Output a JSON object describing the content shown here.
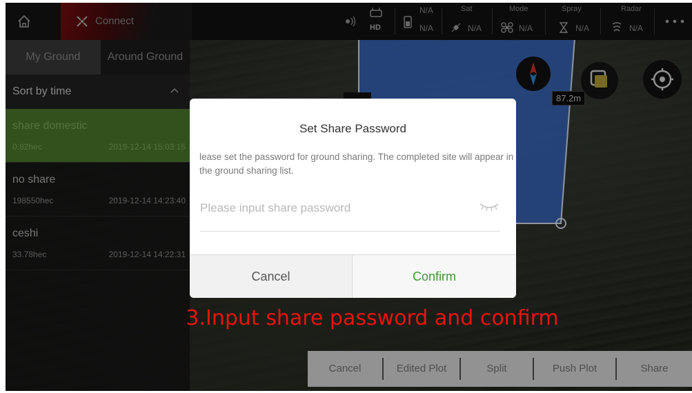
{
  "topbar": {
    "connect_label": "Connect",
    "hd_label": "HD",
    "battery_na": "N/A",
    "status_na_top": "N/A",
    "sat_title": "Sat",
    "sat_value": "N/A",
    "mode_title": "Mode",
    "mode_value": "N/A",
    "spray_title": "Spray",
    "spray_value": "N/A",
    "radar_title": "Radar",
    "radar_value": "N/A"
  },
  "left_panel": {
    "tabs": [
      {
        "label": "My Ground"
      },
      {
        "label": "Around Ground"
      }
    ],
    "sort_label": "Sort by time",
    "items": [
      {
        "name": "share domestic",
        "area": "0.82hec",
        "date": "2019-12-14 15:03:15",
        "selected": true
      },
      {
        "name": "no share",
        "area": "198550hec",
        "date": "2019-12-14 14:23:40",
        "selected": false
      },
      {
        "name": "ceshi",
        "area": "33.78hec",
        "date": "2019-12-14 14:22:31",
        "selected": false
      }
    ]
  },
  "map": {
    "distance_label": "87.2m"
  },
  "dialog": {
    "title": "Set Share Password",
    "description": "lease set the password for ground sharing. The completed site will appear in the ground sharing list.",
    "input_placeholder": "Please input share password",
    "input_value": "",
    "cancel_label": "Cancel",
    "confirm_label": "Confirm"
  },
  "caption": "3.Input share password and confirm",
  "bottom_bar": {
    "buttons": [
      {
        "label": "Cancel"
      },
      {
        "label": "Edited Plot"
      },
      {
        "label": "Split"
      },
      {
        "label": "Push Plot"
      },
      {
        "label": "Share"
      }
    ]
  },
  "colors": {
    "accent_green": "#3a9a2e",
    "selected_row": "#4d7d2b",
    "caption_red": "#e8130f",
    "field_blue": "#3b6fd0"
  },
  "icons": [
    "home-icon",
    "connect-icon",
    "signal-icon",
    "remote-icon",
    "battery-icon",
    "satellite-icon",
    "drone-icon",
    "spray-icon",
    "radar-icon",
    "more-icon",
    "chevron-up-icon",
    "compass-icon",
    "layers-icon",
    "locate-icon",
    "eye-closed-icon"
  ]
}
